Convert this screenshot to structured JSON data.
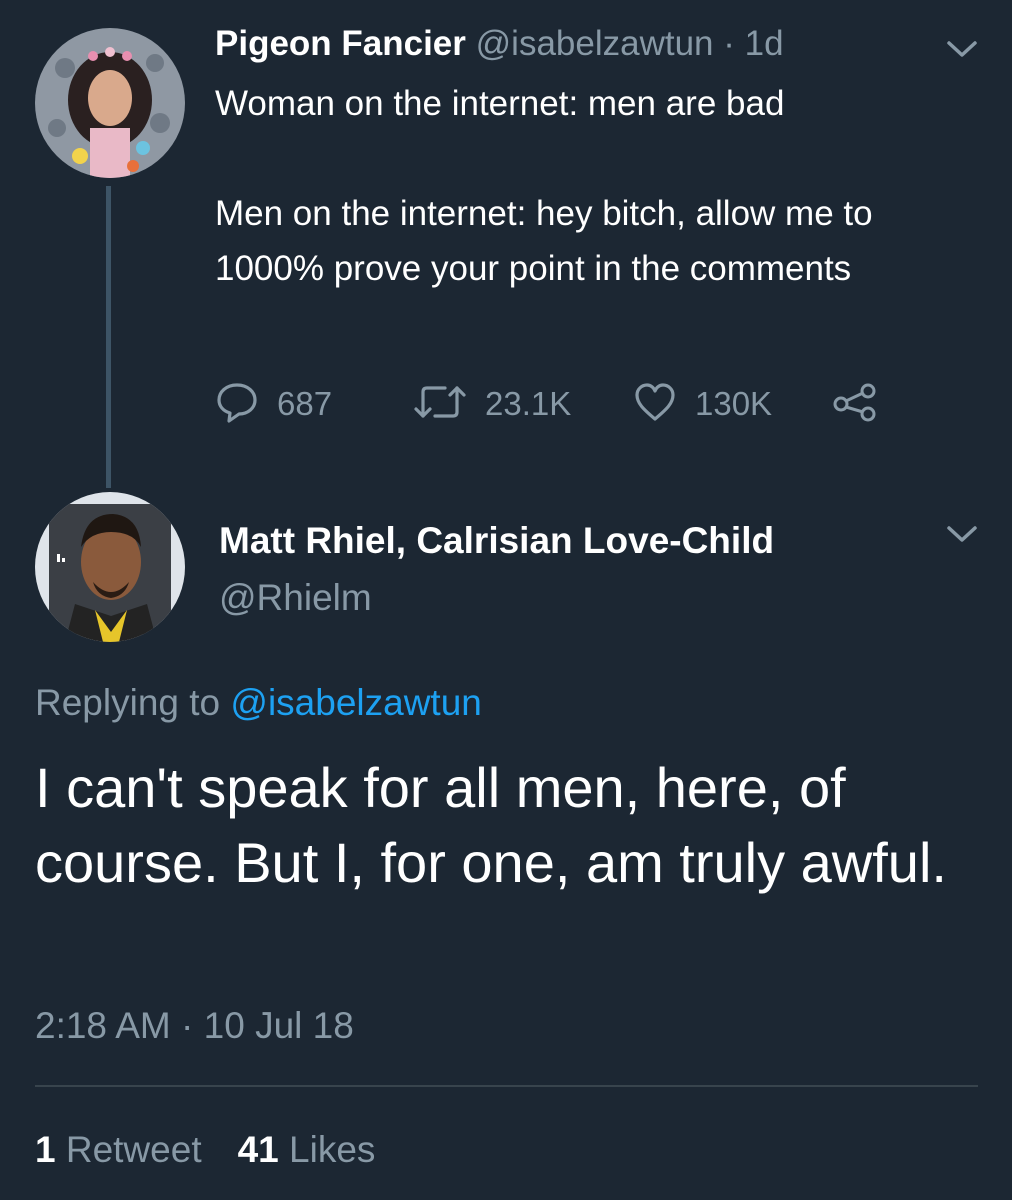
{
  "parent_tweet": {
    "display_name": "Pigeon Fancier",
    "handle": "@isabelzawtun",
    "separator": " · ",
    "age": "1d",
    "text": "Woman on the internet: men are bad\n\nMen on the internet: hey bitch, allow me to 1000% prove your point in the comments",
    "reply_count": "687",
    "retweet_count": "23.1K",
    "like_count": "130K",
    "icons": {
      "reply": "reply-icon",
      "retweet": "retweet-icon",
      "like": "heart-icon",
      "share": "share-icon",
      "menu": "chevron-down-icon"
    }
  },
  "reply_tweet": {
    "display_name": "Matt Rhiel, Calrisian Love-Child",
    "handle": "@Rhielm",
    "replying_prefix": "Replying to ",
    "replying_mention": "@isabelzawtun",
    "text": "I can't speak for all men, here, of course. But I, for one, am truly awful.",
    "time": "2:18 AM",
    "separator": " · ",
    "date": "10 Jul 18",
    "retweets_num": "1",
    "retweets_label": "Retweet",
    "likes_num": "41",
    "likes_label": "Likes"
  },
  "colors": {
    "background": "#1c2733",
    "secondary_text": "#8899a6",
    "link": "#1da1f2",
    "thread_line": "#3d5466"
  }
}
